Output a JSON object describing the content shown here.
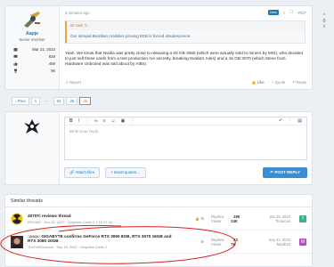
{
  "post": {
    "username": "Aapje",
    "user_title": "Senior member",
    "stats": [
      {
        "icon": "calendar-icon",
        "value": "Mar 21, 2022"
      },
      {
        "icon": "messages-icon",
        "value": "828"
      },
      {
        "icon": "likes-icon",
        "value": "459"
      },
      {
        "icon": "trophy-icon",
        "value": "96"
      }
    ],
    "time": "3 minutes ago",
    "new_badge": "New",
    "post_number": "#627",
    "quote_author": "IB said:",
    "quote_text": "Our intrepid Brazilian modders proving 8GB is forced obsolescence:",
    "body": "Yeah. We know that Nvidia was pretty close to releasing a 20 GB 3080 (which were actually sold to miners by MSI), who decided to just sell these cards from a test production run secretly, breaking Nvidia's rules) and a 16 GB 3070 (which Steve from Hardware Unboxed was told about by AIBs).",
    "report": "Report",
    "like": "Like",
    "quote": "Quote",
    "reply": "Reply",
    "vote_count": "0"
  },
  "pagination": {
    "prev": "‹ Prev",
    "pages": [
      "1",
      "…",
      "24",
      "25",
      "26"
    ]
  },
  "reply_box": {
    "placeholder": "Write your reply...",
    "attach": "Attach files",
    "insert_quotes": "Insert quotes…",
    "post_reply": "POST REPLY"
  },
  "similar": {
    "heading": "Similar threads",
    "threads": [
      {
        "prefix": "",
        "title": "4070Ti reviews thread",
        "meta": "BFG10K · Dec 30, 2022 · Graphics Cards",
        "pages": "2  3  16  17  18",
        "replies": "299",
        "views": "24K",
        "last_date": "Jan 25, 2023",
        "last_user": "Timorous",
        "avatar_letter": "T",
        "avatar_color": "#3fae8c"
      },
      {
        "prefix": "Article",
        "title": "GIGABYTE confirms GeForce RTX 3060 8GB, RTX 3070 16GB and RTX 3080 20GB",
        "meta": "TheF4MChannel · Sep 19, 2020 · Graphics Cards",
        "pages": "2",
        "replies": "43",
        "views": "7K",
        "last_date": "Sep 24, 2020",
        "last_user": "ModE34",
        "avatar_letter": "M",
        "avatar_color": "#b64ac9"
      }
    ],
    "labels": {
      "replies": "Replies:",
      "views": "Views:"
    }
  },
  "colors": {
    "accent": "#2577b1",
    "annotation": "#e02020",
    "primary_button": "#3a8ed3"
  }
}
